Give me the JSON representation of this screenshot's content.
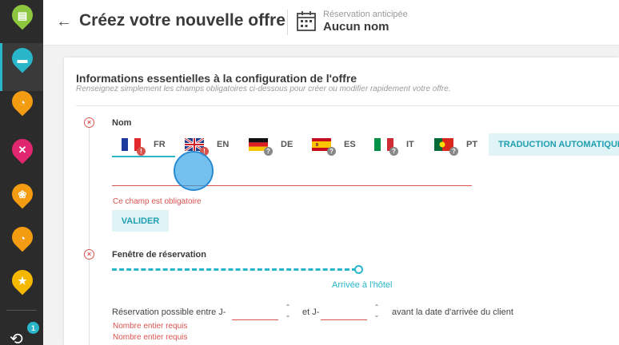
{
  "sidebar": {
    "items": [
      {
        "icon": "building-icon",
        "color": "#8dc63f",
        "glyph": "▤",
        "active": false
      },
      {
        "icon": "bed-icon",
        "color": "#29b6c9",
        "glyph": "▬",
        "active": true
      },
      {
        "icon": "clock-icon",
        "color": "#f39c12",
        "glyph": "◔",
        "active": false
      },
      {
        "icon": "restaurant-icon",
        "color": "#e0266f",
        "glyph": "✕",
        "active": false
      },
      {
        "icon": "spa-icon",
        "color": "#f39c12",
        "glyph": "❀",
        "active": false
      },
      {
        "icon": "clock-icon",
        "color": "#f39c12",
        "glyph": "◔",
        "active": false
      },
      {
        "icon": "star-icon",
        "color": "#f5b800",
        "glyph": "★",
        "active": false
      }
    ],
    "history_badge": "1"
  },
  "header": {
    "back_icon": "arrow-left-icon",
    "title": "Créez votre nouvelle offre",
    "offer_type": "Réservation anticipée",
    "offer_name": "Aucun nom"
  },
  "section": {
    "title": "Informations essentielles à la configuration de l'offre",
    "subtitle": "Renseignez simplement les champs obligatoires ci-dessous pour créer ou modifier rapidement votre offre."
  },
  "name_field": {
    "label": "Nom",
    "languages": [
      {
        "code": "FR",
        "status": "error"
      },
      {
        "code": "EN",
        "status": "error"
      },
      {
        "code": "DE",
        "status": "unknown"
      },
      {
        "code": "ES",
        "status": "unknown"
      },
      {
        "code": "IT",
        "status": "unknown"
      },
      {
        "code": "PT",
        "status": "unknown"
      }
    ],
    "active_language": "FR",
    "auto_translate_label": "TRADUCTION AUTOMATIQUE",
    "value": "",
    "error": "Ce champ est obligatoire",
    "submit_label": "VALIDER"
  },
  "booking_window": {
    "label": "Fenêtre de réservation",
    "timeline_end_label": "Arrivée à l'hôtel",
    "text_before": "Réservation possible entre J-",
    "text_middle": "et J-",
    "text_after": "avant la date d'arrivée du client",
    "min_value": "",
    "max_value": "",
    "error_min": "Nombre entier requis",
    "error_max": "Nombre entier requis"
  },
  "colors": {
    "accent": "#29b6c9",
    "error": "#d9534f",
    "sidebar_bg": "#2b2b2b"
  }
}
